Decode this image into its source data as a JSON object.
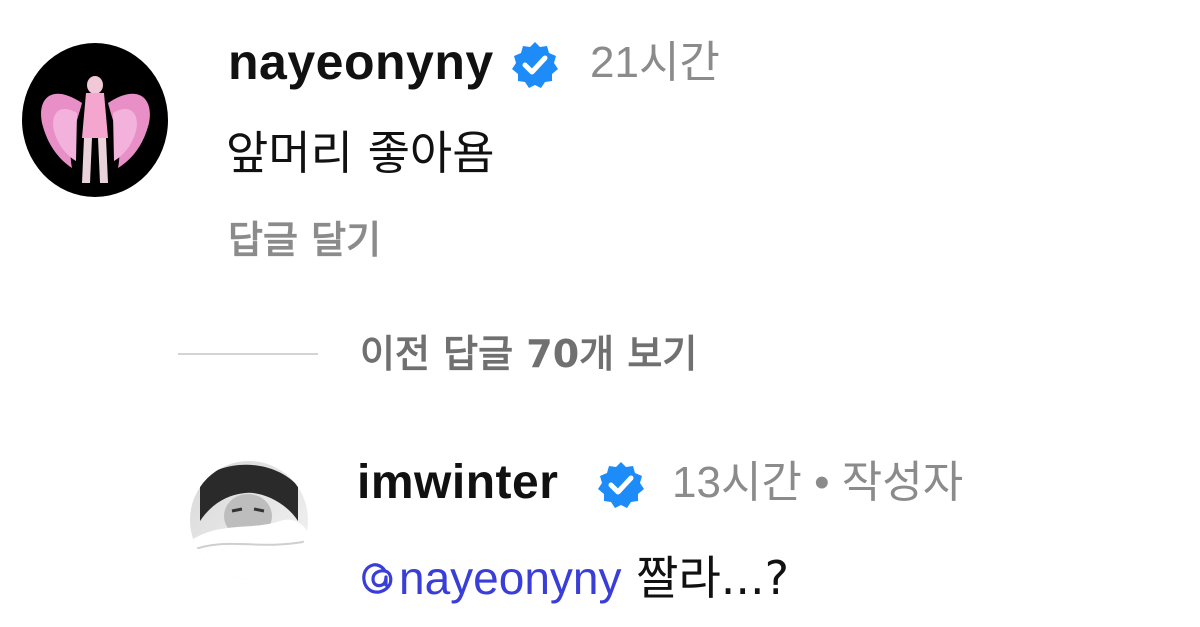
{
  "comment_1": {
    "username": "nayeonyny",
    "verified": true,
    "time": "21시간",
    "text": "앞머리 좋아욤",
    "reply_label": "답글 달기",
    "avatar": "avatar-pink-wings"
  },
  "replies_toggle": {
    "label": "이전 답글 70개 보기"
  },
  "comment_2": {
    "username": "imwinter",
    "verified": true,
    "meta": "13시간 • 작성자",
    "mention": "nayeonyny",
    "text": " 짤라...?",
    "avatar": "avatar-grayscale-portrait"
  },
  "colors": {
    "verified_badge": "#1d8cf8",
    "mention": "#3a3ed9",
    "muted_text": "#8b8b8b"
  },
  "icons": {
    "verified": "verified-badge-icon",
    "mention": "threads-at-icon"
  }
}
